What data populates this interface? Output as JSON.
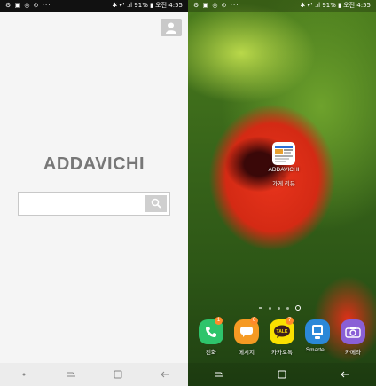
{
  "left": {
    "status": {
      "left_icons": "⚙ ▣ ◎ ⊙ ···",
      "right_text": "✱ ▾⁴ .ıl 91% ▮ 오전 4:55"
    },
    "brand": "ADDAVICHI",
    "search": {
      "value": "",
      "placeholder": ""
    }
  },
  "right": {
    "status": {
      "left_icons": "⚙ ▣ ◎ ⊙ ···",
      "right_text": "✱ ▾⁴ .ıl 91% ▮ 오전 4:55"
    },
    "shortcut": {
      "label": "ADDAVICHI -\n가게 리뷰",
      "icon": "browser-shortcut-icon"
    },
    "dock": [
      {
        "label": "전화",
        "badge": "1",
        "icon": "phone-icon",
        "color": "#2ec46b"
      },
      {
        "label": "메시지",
        "badge": "6",
        "icon": "message-icon",
        "color": "#f59a23"
      },
      {
        "label": "카카오톡",
        "badge": "7",
        "icon": "kakaotalk-icon",
        "color": "#f9e000"
      },
      {
        "label": "Smarte...",
        "badge": "",
        "icon": "smartphone-icon",
        "color": "#2b88d8"
      },
      {
        "label": "카메라",
        "badge": "",
        "icon": "camera-icon",
        "color": "#8a5fd6"
      }
    ]
  }
}
